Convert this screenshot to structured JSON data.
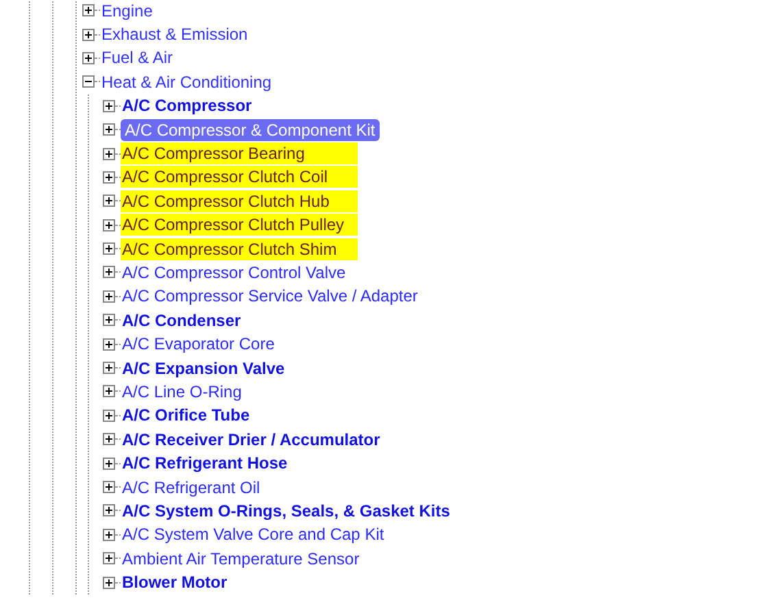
{
  "categories": [
    {
      "label": "Engine",
      "expanded": false
    },
    {
      "label": "Exhaust & Emission",
      "expanded": false
    },
    {
      "label": "Fuel & Air",
      "expanded": false
    },
    {
      "label": "Heat & Air Conditioning",
      "expanded": true,
      "children": [
        {
          "label": "A/C Compressor",
          "bold": true,
          "highlighted": false,
          "selected": false
        },
        {
          "label": "A/C Compressor & Component Kit",
          "bold": false,
          "highlighted": false,
          "selected": true
        },
        {
          "label": "A/C Compressor Bearing",
          "bold": false,
          "highlighted": true,
          "selected": false
        },
        {
          "label": "A/C Compressor Clutch Coil",
          "bold": false,
          "highlighted": true,
          "selected": false
        },
        {
          "label": "A/C Compressor Clutch Hub",
          "bold": false,
          "highlighted": true,
          "selected": false
        },
        {
          "label": "A/C Compressor Clutch Pulley",
          "bold": false,
          "highlighted": true,
          "selected": false
        },
        {
          "label": "A/C Compressor Clutch Shim",
          "bold": false,
          "highlighted": true,
          "selected": false
        },
        {
          "label": "A/C Compressor Control Valve",
          "bold": false,
          "highlighted": false,
          "selected": false
        },
        {
          "label": "A/C Compressor Service Valve / Adapter",
          "bold": false,
          "highlighted": false,
          "selected": false
        },
        {
          "label": "A/C Condenser",
          "bold": true,
          "highlighted": false,
          "selected": false
        },
        {
          "label": "A/C Evaporator Core",
          "bold": false,
          "highlighted": false,
          "selected": false
        },
        {
          "label": "A/C Expansion Valve",
          "bold": true,
          "highlighted": false,
          "selected": false
        },
        {
          "label": "A/C Line O-Ring",
          "bold": false,
          "highlighted": false,
          "selected": false
        },
        {
          "label": "A/C Orifice Tube",
          "bold": true,
          "highlighted": false,
          "selected": false
        },
        {
          "label": "A/C Receiver Drier / Accumulator",
          "bold": true,
          "highlighted": false,
          "selected": false
        },
        {
          "label": "A/C Refrigerant Hose",
          "bold": true,
          "highlighted": false,
          "selected": false
        },
        {
          "label": "A/C Refrigerant Oil",
          "bold": false,
          "highlighted": false,
          "selected": false
        },
        {
          "label": "A/C System O-Rings, Seals, & Gasket Kits",
          "bold": true,
          "highlighted": false,
          "selected": false
        },
        {
          "label": "A/C System Valve Core and Cap Kit",
          "bold": false,
          "highlighted": false,
          "selected": false
        },
        {
          "label": "Ambient Air Temperature Sensor",
          "bold": false,
          "highlighted": false,
          "selected": false
        },
        {
          "label": "Blower Motor",
          "bold": true,
          "highlighted": false,
          "selected": false
        }
      ]
    }
  ]
}
